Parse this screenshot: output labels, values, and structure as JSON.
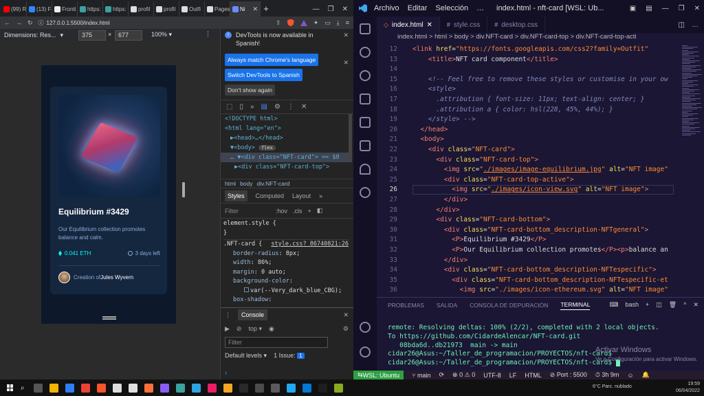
{
  "chrome": {
    "tabs": [
      {
        "label": "(99) R",
        "color": "#ff0000"
      },
      {
        "label": "(13) F",
        "color": "#2d88ff"
      },
      {
        "label": "Fronti",
        "color": "#eeeeee"
      },
      {
        "label": "https:",
        "color": "#3ba1a1"
      },
      {
        "label": "https:",
        "color": "#3ba1a1"
      },
      {
        "label": "profil",
        "color": "#dddddd"
      },
      {
        "label": "profil",
        "color": "#dddddd"
      },
      {
        "label": "Outfi",
        "color": "#dddddd"
      },
      {
        "label": "Pages",
        "color": "#dddddd"
      },
      {
        "label": "Ni",
        "color": "#6a8bff",
        "active": true
      }
    ],
    "url": "127.0.0.1:5500/index.html"
  },
  "device_toolbar": {
    "dimensions_label": "Dimensions: Res...",
    "width": "375",
    "height": "677",
    "zoom": "100%"
  },
  "nft_card": {
    "title": "Equilibrium #3429",
    "description": "Our Equilibrium collection promotes balance and calm.",
    "price": "0.041 ETH",
    "days_left": "3 days left",
    "creator_prefix": "Creation of",
    "creator_name": "Jules Wyvern"
  },
  "devtools": {
    "info_text": "DevTools is now available in Spanish!",
    "btn_match": "Always match Chrome's language",
    "btn_switch": "Switch DevTools to Spanish",
    "btn_dont": "Don't show again",
    "dom_lines": [
      {
        "text": "<!DOCTYPE html>"
      },
      {
        "text": "<html lang=\"en\">"
      },
      {
        "text": "▶<head>…</head>"
      },
      {
        "text": "▼<body>"
      },
      {
        "text": "… ▼<div class=\"NFT-card\"> == $0",
        "sel": true
      },
      {
        "text": "  ▶<div class=\"NFT-card-top\">"
      }
    ],
    "flex_badge": "flex",
    "crumbs": [
      "html",
      "body",
      "div.NFT-card"
    ],
    "style_tabs": [
      "Styles",
      "Computed",
      "Layout",
      "»"
    ],
    "filter_placeholder": "Filter",
    "hov": ":hov",
    "cls": ".cls",
    "element_style": "element.style {",
    "close_brace": "}",
    "selector": ".NFT-card {",
    "source": "style.css?_86740821:26",
    "props": [
      {
        "name": "border-radius",
        "value": "8px"
      },
      {
        "name": "width",
        "value": "86%"
      },
      {
        "name": "margin",
        "value": "0 auto"
      },
      {
        "name": "background-color",
        "value": ""
      },
      {
        "name": "",
        "value": "var(--Very_dark_blue_CBG)"
      },
      {
        "name": "box-shadow",
        "value": ""
      }
    ],
    "drawer_tab": "Console",
    "context": "top",
    "console_filter": "Filter",
    "levels": "Default levels",
    "issues_label": "1 Issue:",
    "issues_count": "1"
  },
  "vscode": {
    "menu": [
      "Archivo",
      "Editar",
      "Selección",
      "…"
    ],
    "title": "index.html - nft-card [WSL: Ub...",
    "tabs": [
      "index.html",
      "style.css",
      "desktop.css"
    ],
    "breadcrumb": "index.html > html > body > div.NFT-card > div.NFT-card-top > div.NFT-card-top-acti",
    "lines": [
      {
        "n": "12",
        "html": "<span class='t'>&lt;link</span> <span class='a'>href</span>=<span class='s'>\"https://fonts.googleapis.com/css2?family=Outfit\"</span>"
      },
      {
        "n": "13",
        "html": "    <span class='t'>&lt;title&gt;</span>NFT card component<span class='t'>&lt;/title&gt;</span>"
      },
      {
        "n": "14",
        "html": ""
      },
      {
        "n": "15",
        "html": "    <span class='c'>&lt;!-- Feel free to remove these styles or customise in your ow</span>"
      },
      {
        "n": "16",
        "html": "    <span class='c'>&lt;style&gt;</span>"
      },
      {
        "n": "17",
        "html": "      <span class='c'>.attribution { font-size: 11px; text-align: center; }</span>"
      },
      {
        "n": "18",
        "html": "      <span class='c'>.attribution a { color: hsl(228, 45%, 44%); }</span>"
      },
      {
        "n": "19",
        "html": "    <span class='c'>&lt;/style&gt; --&gt;</span>"
      },
      {
        "n": "20",
        "html": "  <span class='t'>&lt;/head&gt;</span>"
      },
      {
        "n": "21",
        "html": "  <span class='t'>&lt;body&gt;</span>"
      },
      {
        "n": "22",
        "html": "    <span class='t'>&lt;div</span> <span class='a'>class</span>=<span class='s'>\"NFT-card\"</span><span class='t'>&gt;</span>"
      },
      {
        "n": "23",
        "html": "      <span class='t'>&lt;div</span> <span class='a'>class</span>=<span class='s'>\"NFT-card-top\"</span><span class='t'>&gt;</span>"
      },
      {
        "n": "24",
        "html": "        <span class='t'>&lt;img</span> <span class='a'>src</span>=<span class='s'>\"<span class='u'>./images/image-equilibrium.jpg</span>\"</span> <span class='a'>alt</span>=<span class='s'>\"NFT image\"</span>"
      },
      {
        "n": "25",
        "html": "        <span class='t'>&lt;div</span> <span class='a'>class</span>=<span class='s'>\"NFT-card-top-active\"</span><span class='t'>&gt;</span>"
      },
      {
        "n": "26",
        "html": "          <span class='t'>&lt;img</span> <span class='a'>src</span>=<span class='s'>\"<span class='u'>./images/icon-view.svg</span>\"</span> <span class='a'>alt</span>=<span class='s'>\"NFT image\"</span><span class='t'>&gt;</span>",
        "cur": true
      },
      {
        "n": "27",
        "html": "        <span class='t'>&lt;/div&gt;</span>"
      },
      {
        "n": "28",
        "html": "      <span class='t'>&lt;/div&gt;</span>"
      },
      {
        "n": "29",
        "html": "      <span class='t'>&lt;div</span> <span class='a'>class</span>=<span class='s'>\"NFT-card-bottom\"</span><span class='t'>&gt;</span>"
      },
      {
        "n": "30",
        "html": "        <span class='t'>&lt;div</span> <span class='a'>class</span>=<span class='s'>\"NFT-card-bottom_description-NFTgeneral\"</span><span class='t'>&gt;</span>"
      },
      {
        "n": "31",
        "html": "          <span class='t'>&lt;P&gt;</span>Equilibrium #3429<span class='t'>&lt;/P&gt;</span>"
      },
      {
        "n": "32",
        "html": "          <span class='t'>&lt;P&gt;</span>Our Equilibrium collection promotes<span class='t'>&lt;/P&gt;&lt;p&gt;</span>balance an"
      },
      {
        "n": "33",
        "html": "        <span class='t'>&lt;/div&gt;</span>"
      },
      {
        "n": "34",
        "html": "        <span class='t'>&lt;div</span> <span class='a'>class</span>=<span class='s'>\"NFT-card-bottom_description-NFTespecific\"</span><span class='t'>&gt;</span>"
      },
      {
        "n": "35",
        "html": "          <span class='t'>&lt;div</span> <span class='a'>class</span>=<span class='s'>\"NFT-card-bottom_description-NFTespecific-et</span>"
      },
      {
        "n": "36",
        "html": "            <span class='t'>&lt;img</span> <span class='a'>src</span>=<span class='s'>\"./images/icon-ethereum.svg\"</span> <span class='a'>alt</span>=<span class='s'>\"NFT image\"</span>"
      }
    ],
    "panel_tabs": [
      "PROBLEMAS",
      "SALIDA",
      "CONSOLA DE DEPURACIÓN",
      "TERMINAL"
    ],
    "shell": "bash",
    "terminal": [
      "remote: Resolving deltas: 100% (2/2), completed with 2 local objects.",
      "To https://github.com/CidardeAlencar/NFT-card.git",
      "   08bda6d..db21973  main -> main",
      "cidar26@Asus:~/Taller_de_programacion/PROYECTOS/nft-card$",
      "cidar26@Asus:~/Taller_de_programacion/PROYECTOS/nft-card$ "
    ],
    "activate_title": "Activar Windows",
    "activate_sub": "Ve a Configuración para activar Windows.",
    "status": {
      "wsl": "WSL: Ubuntu",
      "branch": "main",
      "errors": "0",
      "warnings": "0",
      "encoding": "UTF-8",
      "eol": "LF",
      "lang": "HTML",
      "port": "Port : 5500",
      "time": "3h 9m"
    }
  },
  "taskbar": {
    "weather": "6°C  Parc. nublado",
    "time": "19:59",
    "date": "06/04/2022"
  },
  "colors": {
    "accent": "#1a73e8",
    "terminal": "#72f1b8",
    "status_wsl": "#2ea043"
  }
}
